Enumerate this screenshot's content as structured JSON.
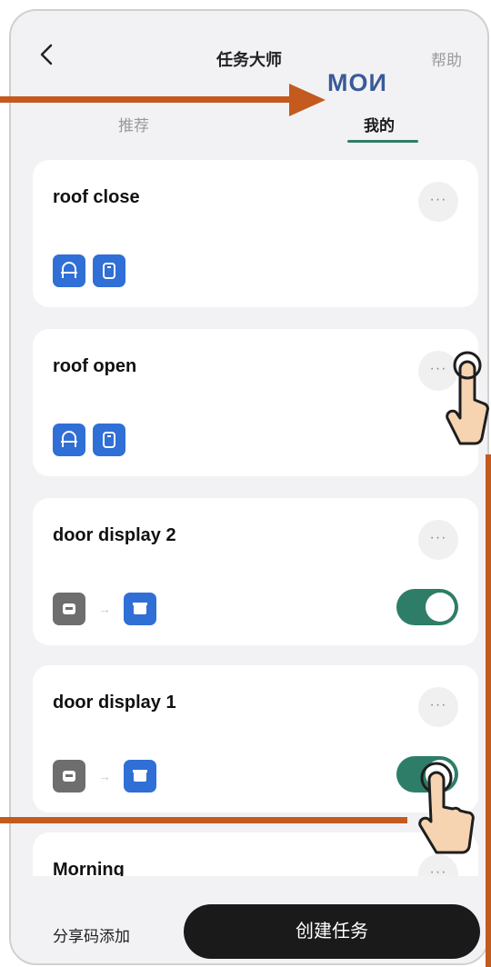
{
  "header": {
    "title": "任务大师",
    "help": "帮助",
    "back_icon": "chevron-left-icon"
  },
  "tabs": [
    {
      "label": "推荐",
      "active": false
    },
    {
      "label": "我的",
      "active": true
    }
  ],
  "annotation": {
    "mine_translation": "МОИ"
  },
  "tasks": [
    {
      "name": "roof close",
      "more": "···",
      "devices": [
        "door-icon",
        "phone-holder-icon"
      ],
      "has_toggle": false
    },
    {
      "name": "roof open",
      "more": "···",
      "devices": [
        "door-icon",
        "phone-holder-icon"
      ],
      "has_toggle": false
    },
    {
      "name": "door display 2",
      "more": "···",
      "devices": [
        "display-icon",
        "box-icon"
      ],
      "arrow": "→",
      "toggle_on": true
    },
    {
      "name": "door display 1",
      "more": "···",
      "devices": [
        "display-icon",
        "box-icon"
      ],
      "arrow": "→",
      "toggle_on": true
    },
    {
      "name": "Morning",
      "more": "···"
    }
  ],
  "footer": {
    "share_label": "分享码添加",
    "create_label": "创建任务"
  },
  "colors": {
    "accent": "#2e7d68",
    "device_blue": "#2f6fd6",
    "device_gray": "#6e6e6e",
    "annotation_orange": "#c45a1e",
    "annotation_blue": "#3a5a98"
  }
}
